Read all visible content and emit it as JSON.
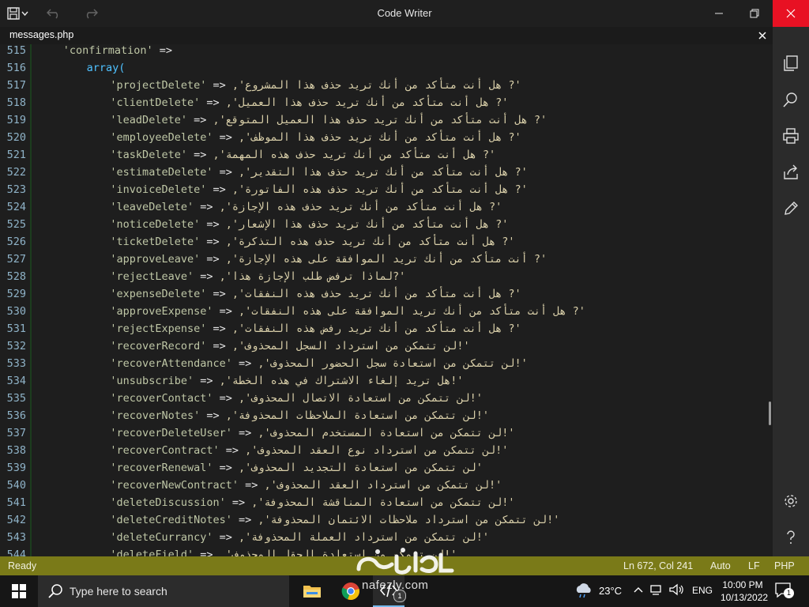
{
  "window": {
    "title": "Code Writer"
  },
  "tab": {
    "name": "messages.php"
  },
  "editor": {
    "lines": [
      {
        "n": "515",
        "indent": 2,
        "key": "'confirmation'",
        "op": " =>",
        "val": ""
      },
      {
        "n": "516",
        "indent": 3,
        "key": "",
        "op": "",
        "val": "",
        "kw": "array("
      },
      {
        "n": "517",
        "indent": 4,
        "key": "'projectDelete'",
        "op": " => ",
        "val": "'? هل أنت متأكد من أنك تريد حذف هذا المشروع',"
      },
      {
        "n": "518",
        "indent": 4,
        "key": "'clientDelete'",
        "op": " => ",
        "val": "'? هل أنت متأكد من أنك تريد حذف هذا العميل',"
      },
      {
        "n": "519",
        "indent": 4,
        "key": "'leadDelete'",
        "op": " => ",
        "val": "'? هل أنت متأكد من أنك تريد حذف هذا العميل المتوقع',"
      },
      {
        "n": "520",
        "indent": 4,
        "key": "'employeeDelete'",
        "op": " => ",
        "val": "'? هل أنت متأكد من أنك تريد حذف هذا الموظف',"
      },
      {
        "n": "521",
        "indent": 4,
        "key": "'taskDelete'",
        "op": " => ",
        "val": "'? هل أنت متأكد من أنك تريد حذف هذه المهمة',"
      },
      {
        "n": "522",
        "indent": 4,
        "key": "'estimateDelete'",
        "op": " => ",
        "val": "'? هل أنت متأكد من أنك تريد حذف هذا التقدير',"
      },
      {
        "n": "523",
        "indent": 4,
        "key": "'invoiceDelete'",
        "op": " => ",
        "val": "'? هل أنت متأكد من أنك تريد حذف هذه الفاتورة',"
      },
      {
        "n": "524",
        "indent": 4,
        "key": "'leaveDelete'",
        "op": " => ",
        "val": "'? هل أنت متأكد من أنك تريد حذف هذه الإجازة',"
      },
      {
        "n": "525",
        "indent": 4,
        "key": "'noticeDelete'",
        "op": " => ",
        "val": "'? هل أنت متأكد من أنك تريد حذف هذا الإشعار',"
      },
      {
        "n": "526",
        "indent": 4,
        "key": "'ticketDelete'",
        "op": " => ",
        "val": "'? هل أنت متأكد من أنك تريد حذف هذه التذكرة',"
      },
      {
        "n": "527",
        "indent": 4,
        "key": "'approveLeave'",
        "op": " => ",
        "val": "'? أنت متأكد من أنك تريد الموافقة على هذه الإجازة',"
      },
      {
        "n": "528",
        "indent": 4,
        "key": "'rejectLeave'",
        "op": " => ",
        "val": "'?لماذا ترفض طلب الإجازة هذا',"
      },
      {
        "n": "529",
        "indent": 4,
        "key": "'expenseDelete'",
        "op": " => ",
        "val": "'? هل أنت متأكد من أنك تريد حذف هذه النفقات',"
      },
      {
        "n": "530",
        "indent": 4,
        "key": "'approveExpense'",
        "op": " => ",
        "val": "'? هل أنت متأكد من أنك تريد الموافقة على هذه النفقات',"
      },
      {
        "n": "531",
        "indent": 4,
        "key": "'rejectExpense'",
        "op": " => ",
        "val": "'? هل أنت متأكد من أنك تريد رفض هذه النفقات',"
      },
      {
        "n": "532",
        "indent": 4,
        "key": "'recoverRecord'",
        "op": " => ",
        "val": "'!لن تتمكن من استرداد السجل المحذوف',"
      },
      {
        "n": "533",
        "indent": 4,
        "key": "'recoverAttendance'",
        "op": " => ",
        "val": "'!لن تتمكن من استعادة سجل الحضور المحذوف',"
      },
      {
        "n": "534",
        "indent": 4,
        "key": "'unsubscribe'",
        "op": " => ",
        "val": "'!هل تريد إلغاء الاشتراك في هذه الخطة',"
      },
      {
        "n": "535",
        "indent": 4,
        "key": "'recoverContact'",
        "op": " => ",
        "val": "'!لن تتمكن من استعادة الاتصال المحذوف',"
      },
      {
        "n": "536",
        "indent": 4,
        "key": "'recoverNotes'",
        "op": " => ",
        "val": "'!لن تتمكن من استعادة الملاحظات المحذوفة',"
      },
      {
        "n": "537",
        "indent": 4,
        "key": "'recoverDeleteUser'",
        "op": " => ",
        "val": "'!لن تتمكن من استعادة المستخدم المحذوف',"
      },
      {
        "n": "538",
        "indent": 4,
        "key": "'recoverContract'",
        "op": " => ",
        "val": "'!لن تتمكن من استرداد نوع العقد المحذوف',"
      },
      {
        "n": "539",
        "indent": 4,
        "key": "'recoverRenewal'",
        "op": " => ",
        "val": "'لن تتمكن من استعادة التجديد المحذوف',"
      },
      {
        "n": "540",
        "indent": 4,
        "key": "'recoverNewContract'",
        "op": " => ",
        "val": "'!لن تتمكن من استرداد العقد المحذوف',"
      },
      {
        "n": "541",
        "indent": 4,
        "key": "'deleteDiscussion'",
        "op": " => ",
        "val": "'!لن تتمكن من استعادة المناقشة المحذوفة',"
      },
      {
        "n": "542",
        "indent": 4,
        "key": "'deleteCreditNotes'",
        "op": " => ",
        "val": "'!لن تتمكن من استرداد ملاحظات الائتمان المحذوفة',"
      },
      {
        "n": "543",
        "indent": 4,
        "key": "'deleteCurrancy'",
        "op": " => ",
        "val": "'!لن تتمكن من استرداد العملة المحذوفة',"
      },
      {
        "n": "544",
        "indent": 4,
        "key": "'deleteField'",
        "op": " => ",
        "val": "'!لن تتمكن من استعادة الحقل المحذوف',"
      }
    ]
  },
  "statusbar": {
    "state": "Ready",
    "position": "Ln 672, Col 241",
    "indent": "Auto",
    "eol": "LF",
    "language": "PHP"
  },
  "taskbar": {
    "search_placeholder": "Type here to search",
    "temperature": "23°C",
    "language": "ENG",
    "time": "10:00 PM",
    "date": "10/13/2022",
    "notifications": "1",
    "app_badge": "1"
  },
  "watermark": {
    "url": "nafezly.com"
  },
  "colors": {
    "statusbar": "#7a7a18",
    "close_button": "#e81123",
    "editor_bg": "#1e1e1e",
    "line_number": "#8fb3c8",
    "keyword": "#4fc1ff"
  }
}
